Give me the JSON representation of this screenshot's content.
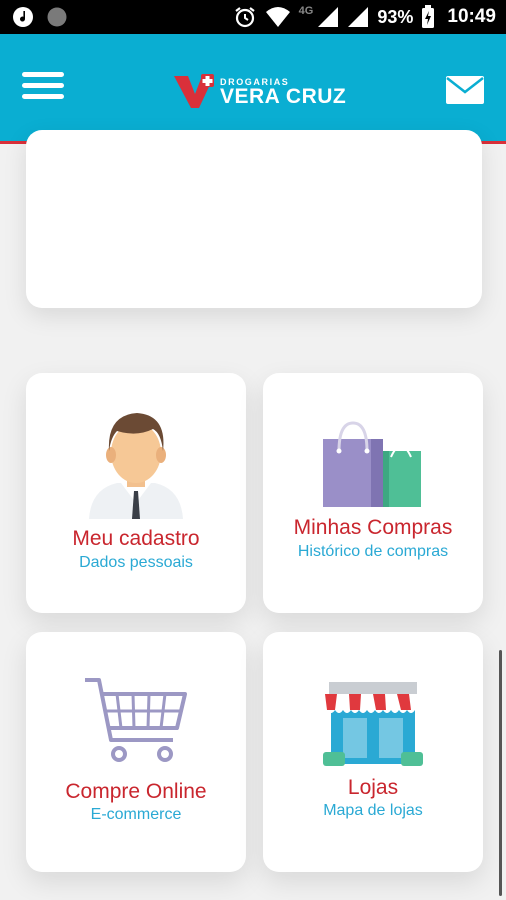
{
  "status_bar": {
    "network": "4G",
    "battery": "93%",
    "time": "10:49"
  },
  "header": {
    "brand_top": "DROGARIAS",
    "brand_main": "VERA CRUZ",
    "brand_color": "#0aaed2",
    "accent_color": "#d9303a"
  },
  "tiles": [
    {
      "title": "Meu cadastro",
      "subtitle": "Dados pessoais",
      "icon": "person-icon"
    },
    {
      "title": "Minhas Compras",
      "subtitle": "Histórico de compras",
      "icon": "shopping-bags-icon"
    },
    {
      "title": "Compre Online",
      "subtitle": "E-commerce",
      "icon": "shopping-cart-icon"
    },
    {
      "title": "Lojas",
      "subtitle": "Mapa de lojas",
      "icon": "store-icon"
    }
  ]
}
